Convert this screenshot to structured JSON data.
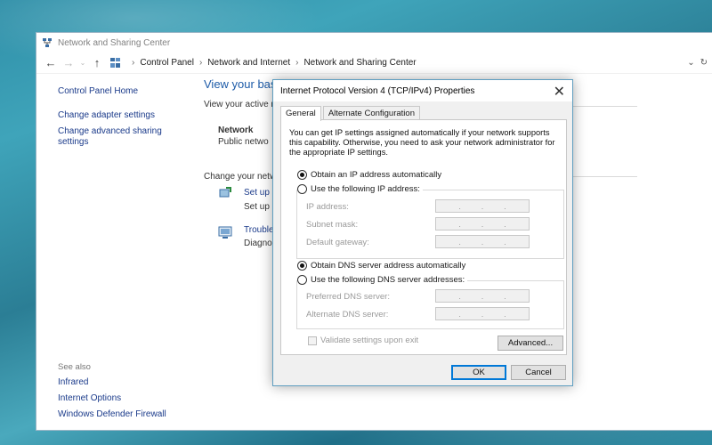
{
  "window": {
    "title": "Network and Sharing Center",
    "breadcrumb": [
      "Control Panel",
      "Network and Internet",
      "Network and Sharing Center"
    ]
  },
  "left_pane": {
    "home": "Control Panel Home",
    "links": [
      "Change adapter settings",
      "Change advanced sharing settings"
    ],
    "see_also_header": "See also",
    "see_also": [
      "Infrared",
      "Internet Options",
      "Windows Defender Firewall"
    ]
  },
  "main": {
    "view_title": "View your bas",
    "active_label": "View your active n",
    "network_name": "Network",
    "network_type": "Public netwo",
    "change_label": "Change your netw",
    "setup_link": "Set up a",
    "setup_desc": "Set up a",
    "trouble_link": "Trouble",
    "trouble_desc": "Diagnos"
  },
  "dialog": {
    "title": "Internet Protocol Version 4 (TCP/IPv4) Properties",
    "tabs": [
      "General",
      "Alternate Configuration"
    ],
    "intro": "You can get IP settings assigned automatically if your network supports this capability. Otherwise, you need to ask your network administrator for the appropriate IP settings.",
    "ip_auto": "Obtain an IP address automatically",
    "ip_manual": "Use the following IP address:",
    "ip_fields": [
      "IP address:",
      "Subnet mask:",
      "Default gateway:"
    ],
    "dns_auto": "Obtain DNS server address automatically",
    "dns_manual": "Use the following DNS server addresses:",
    "dns_fields": [
      "Preferred DNS server:",
      "Alternate DNS server:"
    ],
    "validate": "Validate settings upon exit",
    "advanced": "Advanced...",
    "ok": "OK",
    "cancel": "Cancel",
    "ip_mode": "automatic",
    "dns_mode": "automatic"
  },
  "icons": {
    "close": "close-icon",
    "back": "back-arrow-icon",
    "forward": "forward-arrow-icon",
    "up": "up-arrow-icon",
    "control_panel": "control-panel-icon",
    "refresh": "refresh-icon"
  },
  "colors": {
    "link": "#1a3a8a",
    "title_blue": "#1d5ba8",
    "dialog_border": "#5f9ec0",
    "ok_border": "#0078d7"
  }
}
